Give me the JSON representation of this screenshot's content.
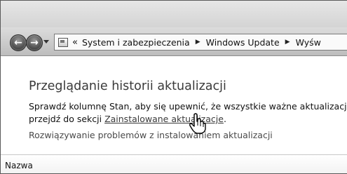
{
  "navigation": {
    "back_icon": "back-arrow-icon",
    "forward_icon": "forward-arrow-icon",
    "recent_pages_icon": "chevron-down-icon"
  },
  "address_bar": {
    "icon": "control-panel-icon",
    "overflow": "«",
    "crumbs": [
      "System i zabezpieczenia",
      "Windows Update",
      "Wyśw"
    ]
  },
  "main": {
    "title": "Przeglądanie historii aktualizacji",
    "description_line1": "Sprawdź kolumnę Stan, aby się upewnić, że wszystkie ważne aktualizacje",
    "description_line2_prefix": "przejdź do sekcji ",
    "installed_updates_link": "Zainstalowane aktualizacje",
    "description_line2_suffix": ".",
    "troubleshoot_link": "Rozwiązywanie problemów z instalowaniem aktualizacji"
  },
  "table": {
    "columns": [
      "Nazwa"
    ]
  },
  "cursor_icon": "hand-pointer-icon"
}
